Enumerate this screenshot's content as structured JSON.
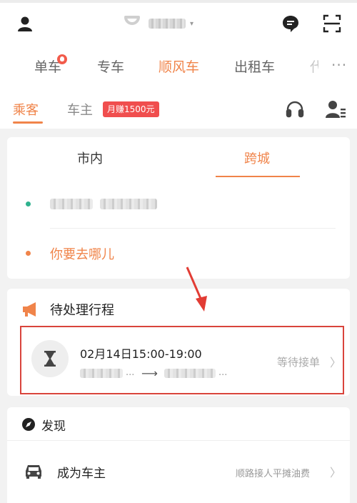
{
  "header": {
    "service_tabs": [
      {
        "label": "单车"
      },
      {
        "label": "专车"
      },
      {
        "label": "顺风车"
      },
      {
        "label": "出租车"
      },
      {
        "label": "代"
      }
    ],
    "more": "···",
    "role_tabs": [
      {
        "label": "乘客"
      },
      {
        "label": "车主"
      }
    ],
    "promo_badge": "月赚1500元",
    "icons": [
      "user-icon",
      "brand-logo",
      "chat-bubble-icon",
      "scan-icon",
      "headset-icon",
      "driver-profile-icon"
    ]
  },
  "route_card": {
    "tabs": [
      {
        "label": "市内"
      },
      {
        "label": "跨城"
      }
    ],
    "destination_prompt": "你要去哪儿"
  },
  "pending": {
    "title": "待处理行程",
    "trip": {
      "time": "02月14日15:00-19:00",
      "ellipsis": "...",
      "route_arrow": "⟶",
      "status": "等待接单"
    }
  },
  "discover": {
    "title": "发现",
    "items": [
      {
        "label": "成为车主",
        "desc": "顺路接人平摊油费"
      }
    ]
  },
  "colors": {
    "accent": "#f0844a",
    "highlight_box": "#d9443c",
    "promo": "#f04e4e",
    "pickup_dot": "#2fb28e"
  }
}
